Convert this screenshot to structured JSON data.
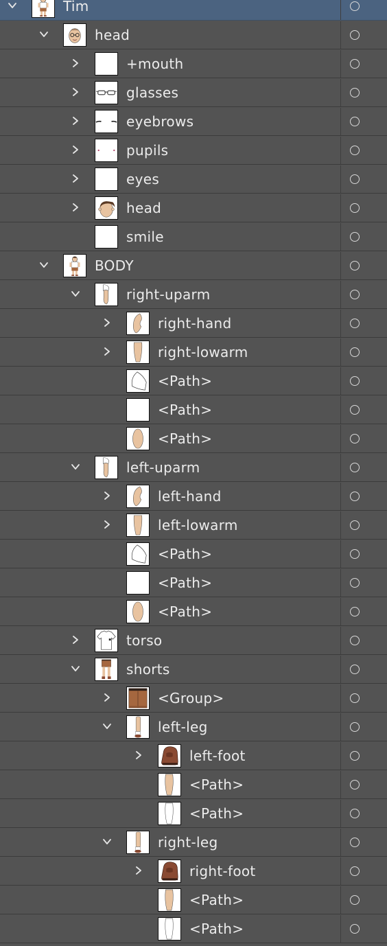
{
  "layers": [
    {
      "label": "Tim",
      "depth": 0,
      "twirl": "open",
      "thumb": "figure",
      "selected": true
    },
    {
      "label": "head",
      "depth": 1,
      "twirl": "open",
      "thumb": "face-glasses"
    },
    {
      "label": "+mouth",
      "depth": 2,
      "twirl": "closed",
      "thumb": "blank"
    },
    {
      "label": "glasses",
      "depth": 2,
      "twirl": "closed",
      "thumb": "glasses"
    },
    {
      "label": "eyebrows",
      "depth": 2,
      "twirl": "closed",
      "thumb": "eyebrows"
    },
    {
      "label": "pupils",
      "depth": 2,
      "twirl": "closed",
      "thumb": "pupils"
    },
    {
      "label": "eyes",
      "depth": 2,
      "twirl": "closed",
      "thumb": "blank"
    },
    {
      "label": "head",
      "depth": 2,
      "twirl": "closed",
      "thumb": "face"
    },
    {
      "label": "smile",
      "depth": 2,
      "twirl": "none",
      "thumb": "blank"
    },
    {
      "label": "BODY",
      "depth": 1,
      "twirl": "open",
      "thumb": "figure"
    },
    {
      "label": "right-uparm",
      "depth": 2,
      "twirl": "open",
      "thumb": "arm"
    },
    {
      "label": "right-hand",
      "depth": 3,
      "twirl": "closed",
      "thumb": "hand"
    },
    {
      "label": "right-lowarm",
      "depth": 3,
      "twirl": "closed",
      "thumb": "lowarm"
    },
    {
      "label": "<Path>",
      "depth": 3,
      "twirl": "none",
      "thumb": "sleeve"
    },
    {
      "label": "<Path>",
      "depth": 3,
      "twirl": "none",
      "thumb": "blank"
    },
    {
      "label": "<Path>",
      "depth": 3,
      "twirl": "none",
      "thumb": "skin-oval"
    },
    {
      "label": "left-uparm",
      "depth": 2,
      "twirl": "open",
      "thumb": "arm"
    },
    {
      "label": "left-hand",
      "depth": 3,
      "twirl": "closed",
      "thumb": "hand"
    },
    {
      "label": "left-lowarm",
      "depth": 3,
      "twirl": "closed",
      "thumb": "lowarm"
    },
    {
      "label": "<Path>",
      "depth": 3,
      "twirl": "none",
      "thumb": "sleeve"
    },
    {
      "label": "<Path>",
      "depth": 3,
      "twirl": "none",
      "thumb": "blank"
    },
    {
      "label": "<Path>",
      "depth": 3,
      "twirl": "none",
      "thumb": "skin-oval"
    },
    {
      "label": "torso",
      "depth": 2,
      "twirl": "closed",
      "thumb": "shirt"
    },
    {
      "label": "shorts",
      "depth": 2,
      "twirl": "open",
      "thumb": "legs"
    },
    {
      "label": "<Group>",
      "depth": 3,
      "twirl": "closed",
      "thumb": "shorts"
    },
    {
      "label": "left-leg",
      "depth": 3,
      "twirl": "open",
      "thumb": "leg"
    },
    {
      "label": "left-foot",
      "depth": 4,
      "twirl": "closed",
      "thumb": "shoe"
    },
    {
      "label": "<Path>",
      "depth": 4,
      "twirl": "none",
      "thumb": "skin-leg"
    },
    {
      "label": "<Path>",
      "depth": 4,
      "twirl": "none",
      "thumb": "white-leg"
    },
    {
      "label": "right-leg",
      "depth": 3,
      "twirl": "open",
      "thumb": "leg"
    },
    {
      "label": "right-foot",
      "depth": 4,
      "twirl": "closed",
      "thumb": "shoe"
    },
    {
      "label": "<Path>",
      "depth": 4,
      "twirl": "none",
      "thumb": "skin-leg"
    },
    {
      "label": "<Path>",
      "depth": 4,
      "twirl": "none",
      "thumb": "white-leg"
    }
  ],
  "colors": {
    "panel_bg": "#535353",
    "selected_bg": "#4b6380",
    "text": "#ececec",
    "skin": "#e8c3a0",
    "hair": "#5b3a24",
    "shoe": "#8a4a32",
    "shorts": "#a5673f"
  }
}
